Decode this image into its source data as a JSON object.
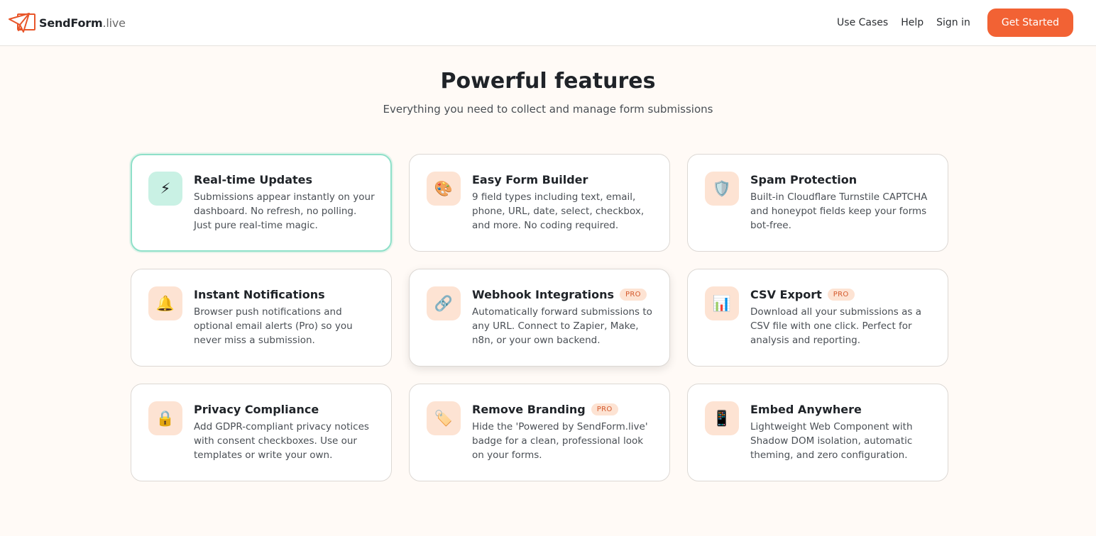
{
  "header": {
    "logo_brand": "SendForm",
    "logo_tld": ".live",
    "nav": [
      {
        "label": "Use Cases"
      },
      {
        "label": "Help"
      },
      {
        "label": "Sign in"
      }
    ],
    "cta_label": "Get Started",
    "accent_color": "#f26234"
  },
  "hero": {
    "title": "Powerful features",
    "subtitle": "Everything you need to collect and manage form submissions"
  },
  "features": [
    {
      "icon": "lightning-icon",
      "glyph": "⚡",
      "title": "Real-time Updates",
      "badge": "",
      "desc": "Submissions appear instantly on your dashboard. No refresh, no polling. Just pure real-time magic."
    },
    {
      "icon": "palette-icon",
      "glyph": "🎨",
      "title": "Easy Form Builder",
      "badge": "",
      "desc": "9 field types including text, email, phone, URL, date, select, checkbox, and more. No coding required."
    },
    {
      "icon": "shield-icon",
      "glyph": "🛡️",
      "title": "Spam Protection",
      "badge": "",
      "desc": "Built-in Cloudflare Turnstile CAPTCHA and honeypot fields keep your forms bot-free."
    },
    {
      "icon": "bell-icon",
      "glyph": "🔔",
      "title": "Instant Notifications",
      "badge": "",
      "desc": "Browser push notifications and optional email alerts (Pro) so you never miss a submission."
    },
    {
      "icon": "link-icon",
      "glyph": "🔗",
      "title": "Webhook Integrations",
      "badge": "PRO",
      "desc": "Automatically forward submissions to any URL. Connect to Zapier, Make, n8n, or your own backend."
    },
    {
      "icon": "bar-chart-icon",
      "glyph": "📊",
      "title": "CSV Export",
      "badge": "PRO",
      "desc": "Download all your submissions as a CSV file with one click. Perfect for analysis and reporting."
    },
    {
      "icon": "lock-icon",
      "glyph": "🔒",
      "title": "Privacy Compliance",
      "badge": "",
      "desc": "Add GDPR-compliant privacy notices with consent checkboxes. Use our templates or write your own."
    },
    {
      "icon": "tag-icon",
      "glyph": "🏷️",
      "title": "Remove Branding",
      "badge": "PRO",
      "desc": "Hide the 'Powered by SendForm.live' badge for a clean, professional look on your forms."
    },
    {
      "icon": "mobile-phone-icon",
      "glyph": "📱",
      "title": "Embed Anywhere",
      "badge": "",
      "desc": "Lightweight Web Component with Shadow DOM isolation, automatic theming, and zero configuration."
    }
  ]
}
